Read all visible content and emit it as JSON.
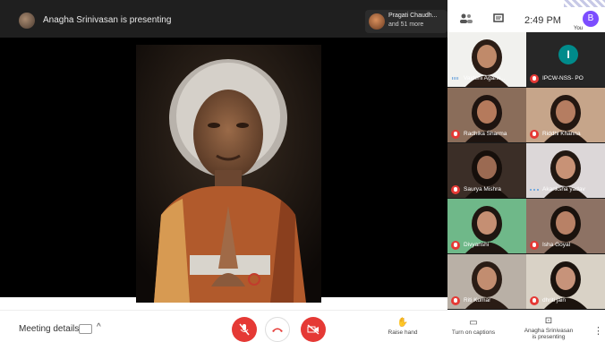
{
  "header": {
    "presenting_text": "Anagha Srinivasan is presenting",
    "chip_line1": "Pragati Chaudh...",
    "chip_line2": "and 51 more",
    "clock": "2:49 PM",
    "you_initial": "B",
    "you_label": "You",
    "right_icons": [
      "people-icon",
      "chat-icon"
    ]
  },
  "participants": [
    {
      "name": "Vaidehi Agarw...",
      "mic": "speaking",
      "bg": "#f1f1ee",
      "skin": "#c08a6a",
      "hair": "#2b1d16"
    },
    {
      "name": "IPCW-NSS- PO",
      "mic": "muted",
      "bg": "#262626",
      "avatar": "I",
      "avatar_color": "#008b8b"
    },
    {
      "name": "Radhika Sharma",
      "mic": "muted",
      "bg": "#8a6d5a",
      "skin": "#b57a5c",
      "hair": "#1e1410"
    },
    {
      "name": "Riddhi Khanna",
      "mic": "muted",
      "bg": "#c6a58a",
      "skin": "#b57d61",
      "hair": "#231711"
    },
    {
      "name": "Saurya Mishra",
      "mic": "muted",
      "bg": "#3b2e27",
      "skin": "#9b6a52",
      "hair": "#160f0b"
    },
    {
      "name": "Akanksha yadav",
      "mic": "dots",
      "bg": "#dcd7d8",
      "skin": "#c89276",
      "hair": "#221812"
    },
    {
      "name": "Divyanshi",
      "mic": "muted",
      "bg": "#6fb889",
      "skin": "#c58f73",
      "hair": "#1f1611"
    },
    {
      "name": "Isha Goyal",
      "mic": "muted",
      "bg": "#8d7264",
      "skin": "#b88166",
      "hair": "#1a120d"
    },
    {
      "name": "Riti Kumar",
      "mic": "muted",
      "bg": "#b9b0a6",
      "skin": "#c28d70",
      "hair": "#2a1c15"
    },
    {
      "name": "dhriti jain",
      "mic": "muted",
      "bg": "#d9d2c6",
      "skin": "#c7937a",
      "hair": "#1b130e"
    }
  ],
  "footer": {
    "meeting_details": "Meeting details",
    "raise_hand": "Raise hand",
    "captions": "Turn on captions",
    "present_line1": "Anagha Srinivasan",
    "present_line2": "is presenting"
  },
  "colors": {
    "danger": "#e53935",
    "topbar": "#1f1f1f",
    "accent": "#7c4dff"
  }
}
